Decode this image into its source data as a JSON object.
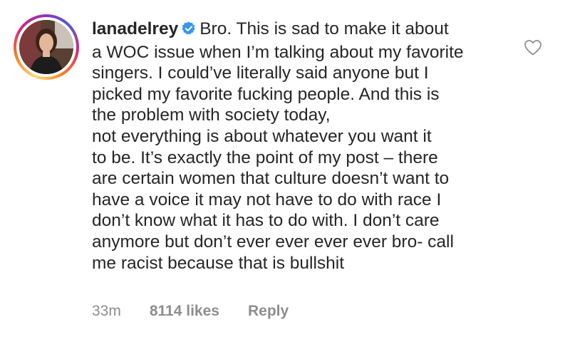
{
  "comment": {
    "username": "lanadelrey",
    "verified": true,
    "text_lines": [
      "Bro. This is sad to make it about",
      "a WOC issue when I’m talking about my favorite",
      "singers. I could’ve literally said anyone but I",
      "picked my favorite fucking people. And this is",
      "the problem with society today,",
      "not everything is about whatever you want it",
      "to be. It’s exactly the point of my post – there",
      "are certain women that culture doesn’t want to",
      "have a voice it may not have to do with race I",
      "don’t know what it has to do with. I don’t care",
      "anymore but don’t ever ever ever ever bro- call",
      "me racist because that is bullshit"
    ],
    "time": "33m",
    "likes": "8114 likes",
    "reply_label": "Reply"
  },
  "icons": {
    "avatar": "profile-photo",
    "verified": "verified-badge-icon",
    "like": "heart-outline-icon"
  },
  "colors": {
    "text": "#262626",
    "meta": "#8e8e8e",
    "verified": "#3897f0",
    "background": "#ffffff"
  }
}
